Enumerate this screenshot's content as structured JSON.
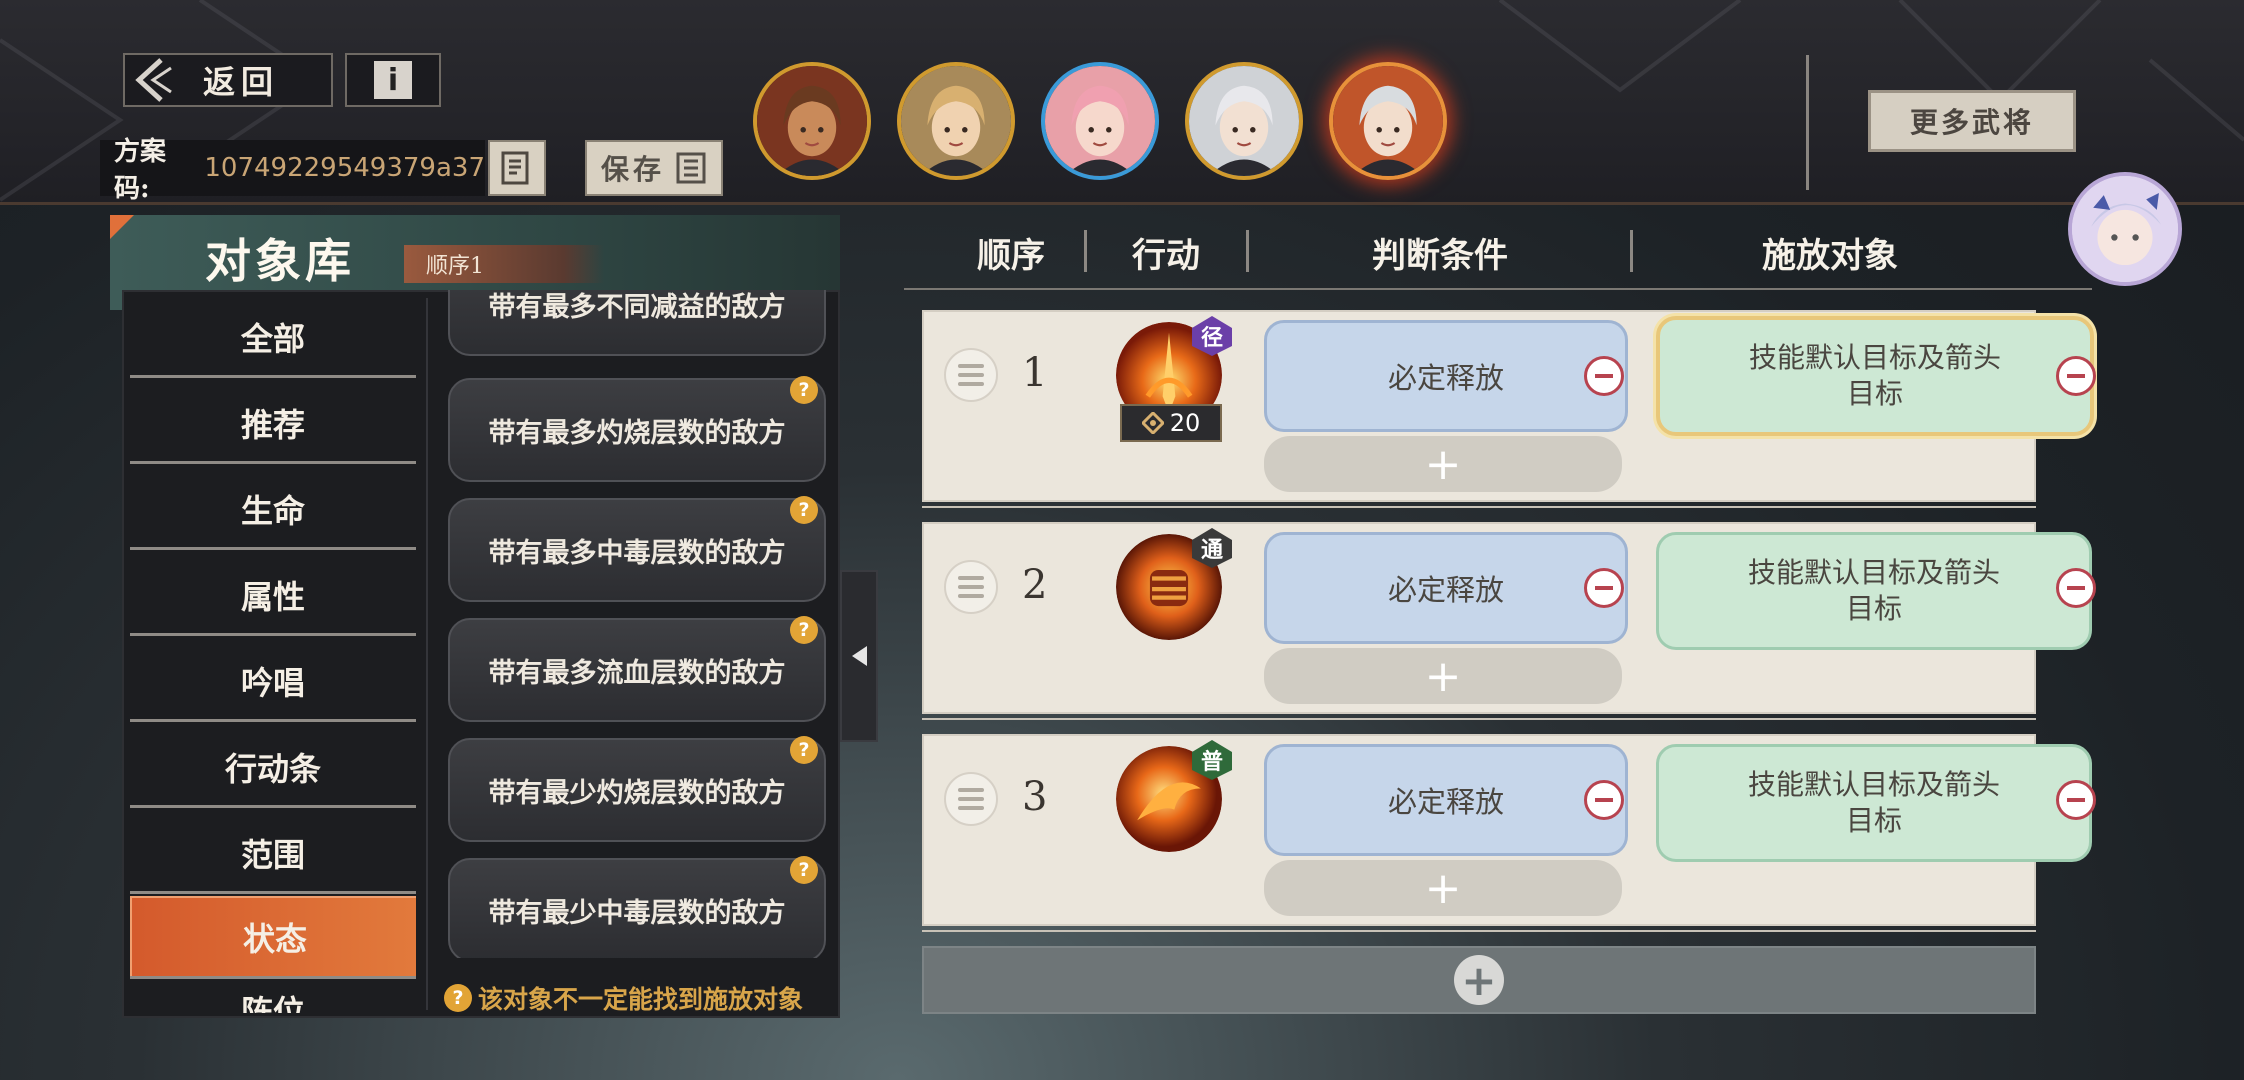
{
  "header": {
    "back_label": "返回",
    "info_label": "i",
    "code_key": "方案码:",
    "code_value": "10749229549379a37",
    "save_label": "保存",
    "more_label": "更多武将"
  },
  "portraits": [
    {
      "name": "portrait-1",
      "skin": "#c98a5a",
      "hair": "#6a3a20",
      "bg": "#7a3520"
    },
    {
      "name": "portrait-2",
      "skin": "#f0d2b0",
      "hair": "#d8b070",
      "bg": "#a88a5a"
    },
    {
      "name": "portrait-3",
      "skin": "#f6d8cc",
      "hair": "#f0a0b0",
      "bg": "#e8a0a8"
    },
    {
      "name": "portrait-4",
      "skin": "#f2e0d2",
      "hair": "#e8e8ec",
      "bg": "#cfd2d6"
    },
    {
      "name": "portrait-5",
      "skin": "#f2ddcc",
      "hair": "#d8dcdf",
      "bg": "#c0552a"
    }
  ],
  "library": {
    "title": "对象库",
    "tag": "顺序1",
    "categories": [
      {
        "label": "全部"
      },
      {
        "label": "推荐"
      },
      {
        "label": "生命"
      },
      {
        "label": "属性"
      },
      {
        "label": "吟唱"
      },
      {
        "label": "行动条"
      },
      {
        "label": "范围"
      },
      {
        "label": "状态",
        "active": true
      },
      {
        "label": "阵位"
      }
    ],
    "options": [
      {
        "label": "带有最多不同减益的敌方"
      },
      {
        "label": "带有最多灼烧层数的敌方"
      },
      {
        "label": "带有最多中毒层数的敌方"
      },
      {
        "label": "带有最多流血层数的敌方"
      },
      {
        "label": "带有最少灼烧层数的敌方"
      },
      {
        "label": "带有最少中毒层数的敌方"
      }
    ],
    "hint": "该对象不一定能找到施放对象",
    "q_mark": "?"
  },
  "table": {
    "headers": [
      "顺序",
      "行动",
      "判断条件",
      "施放对象"
    ],
    "rows": [
      {
        "order": "1",
        "badge": "径",
        "badge_color": "#6b3fa8",
        "cost": "20",
        "condition": "必定释放",
        "target": "技能默认目标及箭头目标",
        "target_line1": "技能默认目标及箭头",
        "target_line2": "目标"
      },
      {
        "order": "2",
        "badge": "通",
        "badge_color": "#3a3a3a",
        "condition": "必定释放",
        "target": "技能默认目标及箭头目标",
        "target_line1": "技能默认目标及箭头",
        "target_line2": "目标"
      },
      {
        "order": "3",
        "badge": "普",
        "badge_color": "#2f6a3a",
        "condition": "必定释放",
        "target": "技能默认目标及箭头目标",
        "target_line1": "技能默认目标及箭头",
        "target_line2": "目标"
      }
    ],
    "add_symbol": "+"
  },
  "colors": {
    "accent": "#e27a3c",
    "condition_fill": "#c6d6ea",
    "target_fill": "#cde8d4",
    "delete": "#b7434f",
    "hint": "#d8a54a"
  }
}
